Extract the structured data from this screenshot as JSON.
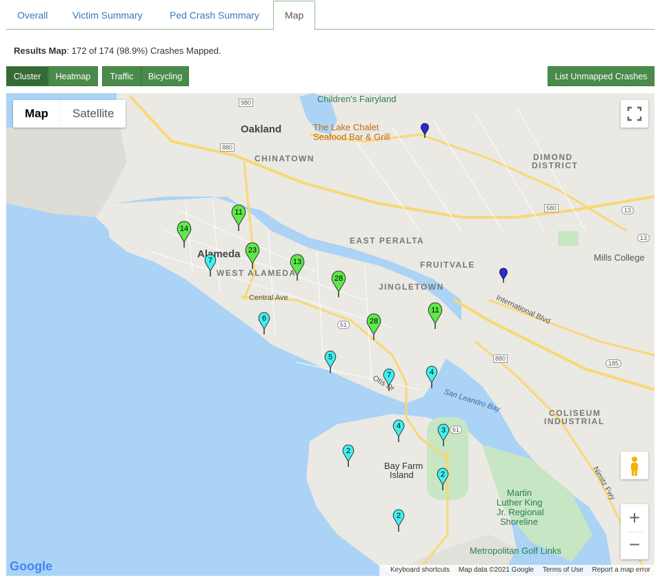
{
  "tabs": [
    {
      "label": "Overall"
    },
    {
      "label": "Victim Summary"
    },
    {
      "label": "Ped Crash Summary"
    },
    {
      "label": "Map"
    }
  ],
  "summary": {
    "bold": "Results Map",
    "text": ": 172 of 174 (98.9%) Crashes Mapped."
  },
  "buttons": {
    "cluster": "Cluster",
    "heatmap": "Heatmap",
    "traffic": "Traffic",
    "bicycling": "Bicycling",
    "unmapped": "List Unmapped Crashes"
  },
  "map": {
    "type_control": {
      "map": "Map",
      "satellite": "Satellite"
    },
    "zoom": {
      "in": "+",
      "out": "−"
    },
    "attribution": {
      "shortcuts": "Keyboard shortcuts",
      "data": "Map data ©2021 Google",
      "terms": "Terms of Use",
      "report": "Report a map error"
    },
    "logo": "Google",
    "places": {
      "oakland": "Oakland",
      "alameda": "Alameda",
      "west_alameda": "WEST ALAMEDA",
      "chinatown": "CHINATOWN",
      "east_peralta": "EAST PERALTA",
      "fruitvale": "FRUITVALE",
      "jingletown": "JINGLETOWN",
      "dimond1": "DIMOND",
      "dimond2": "DISTRICT",
      "coliseum1": "COLISEUM",
      "coliseum2": "INDUSTRIAL",
      "bay_farm1": "Bay Farm",
      "bay_farm2": "Island",
      "mills": "Mills College",
      "childrens": "Children's Fairyland",
      "lake_chalet1": "The Lake Chalet",
      "lake_chalet2": "Seafood Bar & Grill",
      "mlk1": "Martin",
      "mlk2": "Luther King",
      "mlk3": "Jr. Regional",
      "mlk4": "Shoreline",
      "metro_golf": "Metropolitan Golf Links",
      "san_leandro_bay": "San Leandro Bay",
      "central_ave": "Central Ave",
      "intl_blvd": "International Blvd",
      "nimitz": "Nimitz Fwy",
      "otis": "Otis Dr"
    },
    "highways": [
      "880",
      "980",
      "580",
      "13",
      "13",
      "61",
      "61",
      "185",
      "880"
    ],
    "markers": [
      {
        "count": "14",
        "color": "green"
      },
      {
        "count": "11",
        "color": "green"
      },
      {
        "count": "23",
        "color": "green"
      },
      {
        "count": "13",
        "color": "green"
      },
      {
        "count": "28",
        "color": "green"
      },
      {
        "count": "28",
        "color": "green"
      },
      {
        "count": "11",
        "color": "green"
      },
      {
        "count": "7",
        "color": "cyan"
      },
      {
        "count": "6",
        "color": "cyan"
      },
      {
        "count": "5",
        "color": "cyan"
      },
      {
        "count": "7",
        "color": "cyan"
      },
      {
        "count": "4",
        "color": "cyan"
      },
      {
        "count": "4",
        "color": "cyan"
      },
      {
        "count": "3",
        "color": "cyan"
      },
      {
        "count": "2",
        "color": "cyan"
      },
      {
        "count": "2",
        "color": "cyan"
      },
      {
        "count": "2",
        "color": "cyan"
      },
      {
        "count": "",
        "color": "blue"
      },
      {
        "count": "",
        "color": "blue"
      }
    ],
    "colors": {
      "green": "#5ee84a",
      "cyan": "#3ff0f0",
      "blue": "#2a2ad8",
      "land": "#ebe9e4",
      "water": "#aad3f5",
      "park": "#c7e6c3",
      "highway": "#f7d874"
    }
  }
}
